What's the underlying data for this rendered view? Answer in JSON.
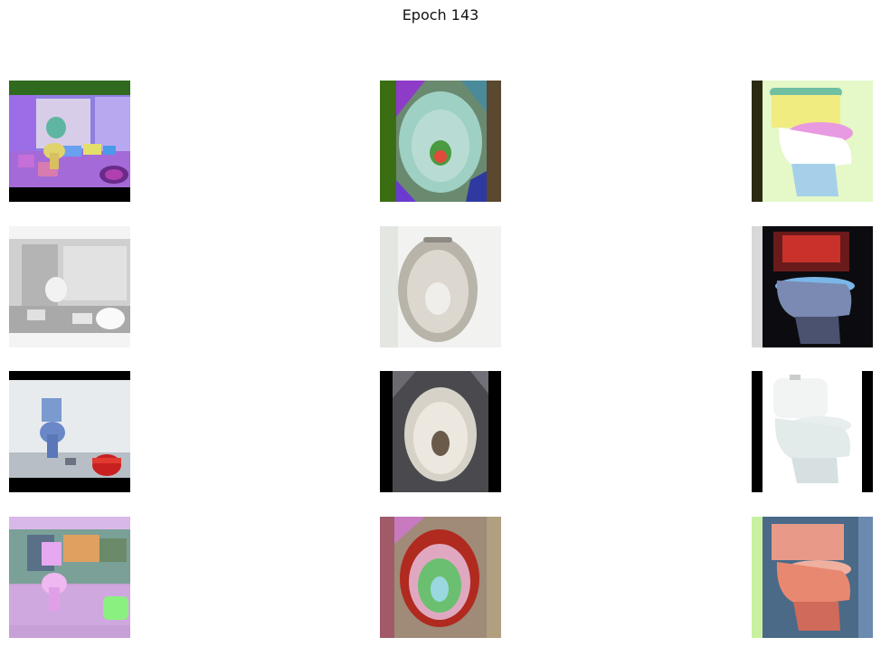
{
  "figure": {
    "title": "Epoch 143"
  },
  "grid": {
    "rows": 4,
    "cols": 3,
    "images": [
      {
        "icon": "bathroom-scene-icon",
        "palette": "purple-green-stylized"
      },
      {
        "icon": "toilet-bowl-topdown-icon",
        "palette": "teal-colorful-stylized"
      },
      {
        "icon": "toilet-sideview-icon",
        "palette": "pastel-yellow-pink-blue"
      },
      {
        "icon": "bathroom-scene-icon",
        "palette": "grayscale-faded"
      },
      {
        "icon": "toilet-bowl-topdown-icon",
        "palette": "gray-white"
      },
      {
        "icon": "toilet-sideview-icon",
        "palette": "dark-red-blue"
      },
      {
        "icon": "bathroom-scene-icon",
        "palette": "blue-gray-red-bucket"
      },
      {
        "icon": "toilet-bowl-topdown-icon",
        "palette": "white-on-dark"
      },
      {
        "icon": "toilet-sideview-icon",
        "palette": "white-product"
      },
      {
        "icon": "bathroom-scene-icon",
        "palette": "pink-green-stylized"
      },
      {
        "icon": "toilet-bowl-topdown-icon",
        "palette": "red-green-stylized"
      },
      {
        "icon": "toilet-sideview-icon",
        "palette": "salmon-blue-stylized"
      }
    ]
  }
}
